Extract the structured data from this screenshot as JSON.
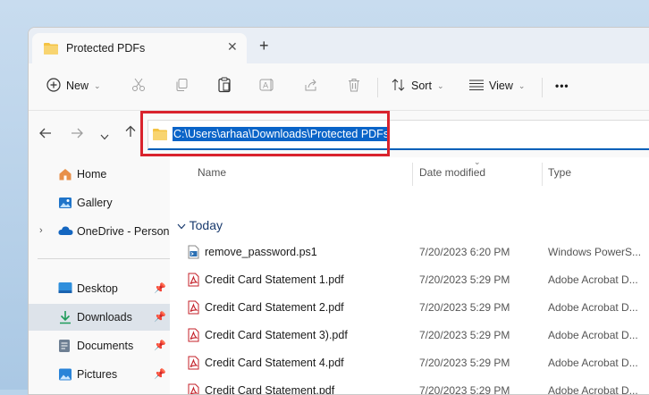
{
  "tab": {
    "title": "Protected PDFs",
    "close": "✕",
    "new_tab": "+"
  },
  "toolbar": {
    "new_label": "New",
    "sort_label": "Sort",
    "view_label": "View",
    "more": "•••"
  },
  "address": {
    "path": "C:\\Users\\arhaa\\Downloads\\Protected PDFs"
  },
  "sidebar": {
    "items": [
      {
        "label": "Home",
        "icon": "home-icon"
      },
      {
        "label": "Gallery",
        "icon": "gallery-icon"
      },
      {
        "label": "OneDrive - Persona",
        "icon": "cloud-icon"
      },
      {
        "label": "Desktop",
        "icon": "desktop-icon"
      },
      {
        "label": "Downloads",
        "icon": "download-icon"
      },
      {
        "label": "Documents",
        "icon": "documents-icon"
      },
      {
        "label": "Pictures",
        "icon": "pictures-icon"
      }
    ]
  },
  "columns": {
    "name": "Name",
    "date": "Date modified",
    "type": "Type"
  },
  "group": {
    "label": "Today"
  },
  "files": [
    {
      "name": "remove_password.ps1",
      "date": "7/20/2023 6:20 PM",
      "type": "Windows PowerS...",
      "icon": "script-file-icon"
    },
    {
      "name": "Credit Card Statement 1.pdf",
      "date": "7/20/2023 5:29 PM",
      "type": "Adobe Acrobat D...",
      "icon": "pdf-file-icon"
    },
    {
      "name": "Credit Card Statement 2.pdf",
      "date": "7/20/2023 5:29 PM",
      "type": "Adobe Acrobat D...",
      "icon": "pdf-file-icon"
    },
    {
      "name": "Credit Card Statement 3).pdf",
      "date": "7/20/2023 5:29 PM",
      "type": "Adobe Acrobat D...",
      "icon": "pdf-file-icon"
    },
    {
      "name": "Credit Card Statement 4.pdf",
      "date": "7/20/2023 5:29 PM",
      "type": "Adobe Acrobat D...",
      "icon": "pdf-file-icon"
    },
    {
      "name": "Credit Card Statement.pdf",
      "date": "7/20/2023 5:29 PM",
      "type": "Adobe Acrobat D...",
      "icon": "pdf-file-icon"
    }
  ],
  "colors": {
    "accent": "#0a64c8",
    "highlight": "#d9232d",
    "pdf": "#c4212a",
    "folder": "#f4c343"
  }
}
